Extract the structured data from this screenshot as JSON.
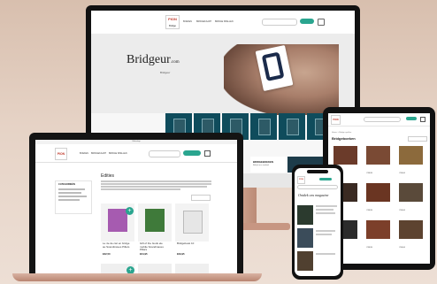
{
  "brand": {
    "name": "PION",
    "sub": "Bridge"
  },
  "desktop": {
    "nav": [
      "BOEKEN",
      "BRIDGEKAART",
      "BRIDGE SPELLEN"
    ],
    "hero_logo": "Bridgeur",
    "hero_logo_sub": ".com",
    "hero_tag": "Bridgeur",
    "promo_title": "BRIDGEBOEKEN",
    "promo_sub": "Bekijk ons aanbod"
  },
  "laptop": {
    "title_bar": "Webshop",
    "nav": [
      "BOEKEN",
      "BRIDGEKAART",
      "BRIDGE SPELLEN"
    ],
    "heading": "Edities",
    "sidebar_title": "CATEGORIEËN",
    "products": [
      {
        "title": "Le 4e de ciel en bridge au Scandinaves Pillars",
        "price": "€32,50"
      },
      {
        "title": "Gift of the Gods ele mobile Scandinaves Pillars",
        "price": "€24,95"
      },
      {
        "title": "Bridgeboek 10",
        "price": "€29,95"
      }
    ]
  },
  "tablet": {
    "heading": "Bridgeboeken",
    "breadcrumb": "Home > Bridge spellen",
    "prices": [
      "€45,00",
      "€39,95",
      "€59,00",
      "€45,00",
      "€39,95",
      "€59,00",
      "€45,00",
      "€39,95",
      "€59,00"
    ]
  },
  "phone": {
    "heading": "Ontdek ons magazine"
  },
  "colors": {
    "accent": "#2aa58f",
    "brand_red": "#c0392b",
    "tile_blue": "#0f4c5c"
  }
}
